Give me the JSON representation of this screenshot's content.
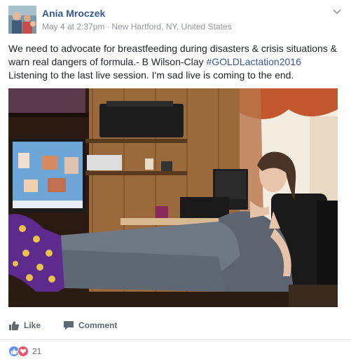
{
  "post": {
    "author": "Ania Mroczek",
    "date": "May 4 at 2:37pm",
    "separator": "·",
    "location": "New Hartford, NY, United States",
    "text_line1": "We need to advocate for breastfeeding during disasters & crisis situations &",
    "text_line2_a": "warn real dangers of formula.- B Wilson-Clay ",
    "hashtag": "#GOLDLactation2016",
    "text_line3": "Listening to the last live session. I'm sad live is coming to the end."
  },
  "actions": {
    "like_label": "Like",
    "comment_label": "Comment"
  },
  "reactions": {
    "count": "21",
    "icons": [
      "like-icon",
      "love-icon"
    ]
  },
  "colors": {
    "link": "#365899",
    "meta": "#90949c",
    "like_blue": "#5890ff",
    "love_red": "#f25268"
  }
}
